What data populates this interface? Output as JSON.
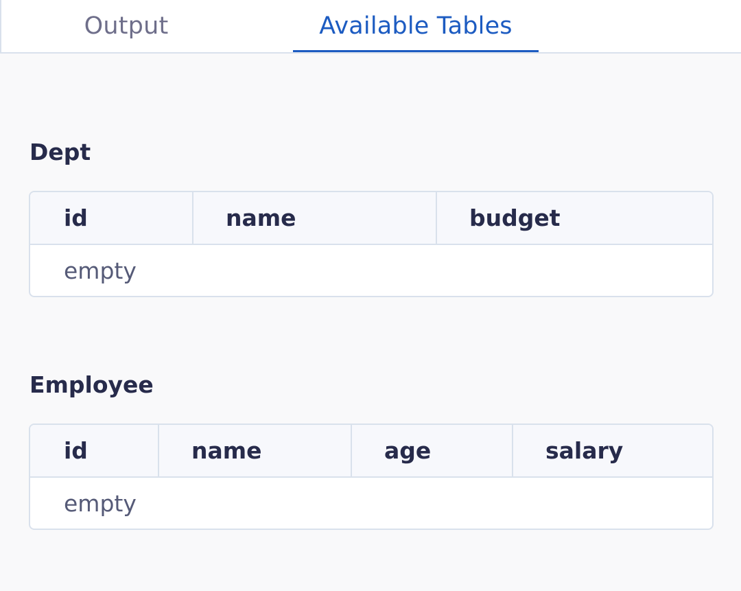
{
  "tabs": [
    {
      "label": "Output",
      "active": false
    },
    {
      "label": "Available Tables",
      "active": true
    }
  ],
  "tables": {
    "dept": {
      "title": "Dept",
      "columns": [
        "id",
        "name",
        "budget"
      ],
      "empty_text": "empty"
    },
    "employee": {
      "title": "Employee",
      "columns": [
        "id",
        "name",
        "age",
        "salary"
      ],
      "empty_text": "empty"
    }
  },
  "colors": {
    "accent": "#1c5bc1",
    "text": "#272b4b",
    "muted": "#6e6e8a",
    "border": "#d9e1ec",
    "background": "#f9f9fa"
  }
}
